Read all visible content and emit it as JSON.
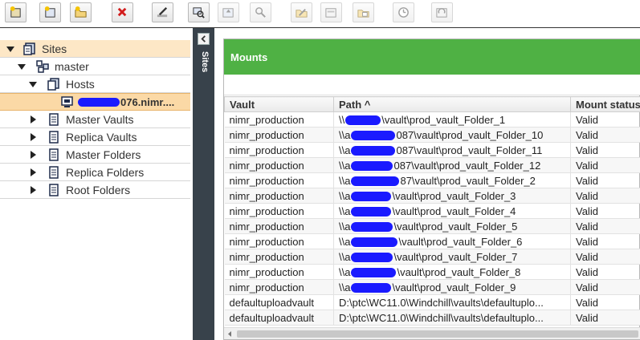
{
  "toolbar": {
    "buttons": [
      {
        "name": "new-site-icon",
        "enabled": true
      },
      {
        "name": "new-host-icon",
        "enabled": true
      },
      {
        "name": "new-folder-icon",
        "enabled": true
      },
      {
        "name": "delete-icon",
        "enabled": true
      },
      {
        "name": "edit-icon",
        "enabled": true
      },
      {
        "name": "mount-icon",
        "enabled": true
      },
      {
        "name": "replicate-icon",
        "enabled": false
      },
      {
        "name": "search-icon",
        "enabled": false
      },
      {
        "name": "set-read-only-icon",
        "enabled": false
      },
      {
        "name": "folder-settings-icon",
        "enabled": false
      },
      {
        "name": "move-icon",
        "enabled": false
      },
      {
        "name": "schedule-icon",
        "enabled": false
      },
      {
        "name": "revaulting-icon",
        "enabled": false
      }
    ]
  },
  "tree": {
    "sites_label": "Sites",
    "master_label": "master",
    "hosts_label": "Hosts",
    "host_label_visible": "076.nimr....",
    "master_vaults_label": "Master Vaults",
    "replica_vaults_label": "Replica Vaults",
    "master_folders_label": "Master Folders",
    "replica_folders_label": "Replica Folders",
    "root_folders_label": "Root Folders"
  },
  "side_panel": {
    "label": "Sites"
  },
  "panel": {
    "title": "Mounts",
    "columns": [
      "Vault",
      "Path ^",
      "Mount status"
    ],
    "rows": [
      {
        "vault": "nimr_production",
        "path_prefix": "\\\\",
        "path_suffix": "\\vault\\prod_vault_Folder_1",
        "status": "Valid"
      },
      {
        "vault": "nimr_production",
        "path_prefix": "\\\\a",
        "path_suffix": "087\\vault\\prod_vault_Folder_10",
        "status": "Valid"
      },
      {
        "vault": "nimr_production",
        "path_prefix": "\\\\a",
        "path_suffix": "087\\vault\\prod_vault_Folder_11",
        "status": "Valid"
      },
      {
        "vault": "nimr_production",
        "path_prefix": "\\\\a",
        "path_suffix": "087\\vault\\prod_vault_Folder_12",
        "status": "Valid"
      },
      {
        "vault": "nimr_production",
        "path_prefix": "\\\\a",
        "path_suffix": "87\\vault\\prod_vault_Folder_2",
        "status": "Valid"
      },
      {
        "vault": "nimr_production",
        "path_prefix": "\\\\a",
        "path_suffix": "\\vault\\prod_vault_Folder_3",
        "status": "Valid"
      },
      {
        "vault": "nimr_production",
        "path_prefix": "\\\\a",
        "path_suffix": "\\vault\\prod_vault_Folder_4",
        "status": "Valid"
      },
      {
        "vault": "nimr_production",
        "path_prefix": "\\\\a",
        "path_suffix": "\\vault\\prod_vault_Folder_5",
        "status": "Valid"
      },
      {
        "vault": "nimr_production",
        "path_prefix": "\\\\a",
        "path_suffix": "\\vault\\prod_vault_Folder_6",
        "status": "Valid"
      },
      {
        "vault": "nimr_production",
        "path_prefix": "\\\\a",
        "path_suffix": "\\vault\\prod_vault_Folder_7",
        "status": "Valid"
      },
      {
        "vault": "nimr_production",
        "path_prefix": "\\\\a",
        "path_suffix": "\\vault\\prod_vault_Folder_8",
        "status": "Valid"
      },
      {
        "vault": "nimr_production",
        "path_prefix": "\\\\a",
        "path_suffix": "\\vault\\prod_vault_Folder_9",
        "status": "Valid"
      },
      {
        "vault": "defaultuploadvault",
        "path_prefix": "D:\\ptc\\WC11.0\\Windchill\\vaults\\defaultuplo...",
        "path_suffix": "",
        "status": "Valid"
      },
      {
        "vault": "defaultuploadvault",
        "path_prefix": "D:\\ptc\\WC11.0\\Windchill\\vaults\\defaultuplo...",
        "path_suffix": "",
        "status": "Valid"
      }
    ]
  },
  "colors": {
    "header_green": "#4fb144",
    "tree_highlight": "#fde7c6",
    "tree_selected": "#fbd9a6",
    "splitter": "#38424b",
    "redaction": "#1a1aff"
  }
}
